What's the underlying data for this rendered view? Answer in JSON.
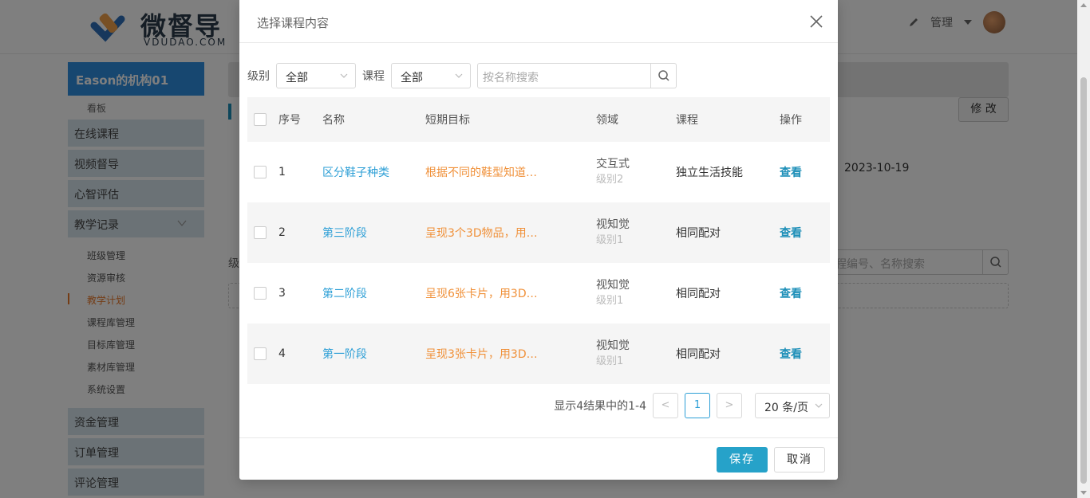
{
  "app": {
    "logo_cn": "微督导",
    "logo_en": "VDUDAO.COM",
    "user_menu_label": "管理"
  },
  "sidebar": {
    "org_name": "Eason的机构01",
    "dashboard_label": "看板",
    "items": [
      {
        "label": "在线课程"
      },
      {
        "label": "视频督导"
      },
      {
        "label": "心智评估"
      },
      {
        "label": "教学记录"
      }
    ],
    "teaching_children": [
      {
        "label": "班级管理"
      },
      {
        "label": "资源审核"
      },
      {
        "label": "教学计划"
      },
      {
        "label": "课程库管理"
      },
      {
        "label": "目标库管理"
      },
      {
        "label": "素材库管理"
      },
      {
        "label": "系统设置"
      }
    ],
    "bottom_items": [
      {
        "label": "资金管理"
      },
      {
        "label": "订单管理"
      },
      {
        "label": "评论管理"
      }
    ]
  },
  "background": {
    "edit_button": "修 改",
    "date": "2023-10-19",
    "search_placeholder": "程编号、名称搜索",
    "left_label": "级",
    "section_mark": "扌"
  },
  "modal": {
    "title": "选择课程内容",
    "filters": {
      "level_label": "级别",
      "level_value": "全部",
      "course_label": "课程",
      "course_value": "全部",
      "search_placeholder": "按名称搜索"
    },
    "columns": {
      "no": "序号",
      "name": "名称",
      "goal": "短期目标",
      "area": "领域",
      "course": "课程",
      "op": "操作"
    },
    "rows": [
      {
        "no": "1",
        "name": "区分鞋子种类",
        "goal": "根据不同的鞋型知道…",
        "area": "交互式",
        "level": "级别2",
        "course": "独立生活技能",
        "op": "查看"
      },
      {
        "no": "2",
        "name": "第三阶段",
        "goal": "呈现3个3D物品，用…",
        "area": "视知觉",
        "level": "级别1",
        "course": "相同配对",
        "op": "查看"
      },
      {
        "no": "3",
        "name": "第二阶段",
        "goal": "呈现6张卡片，用3D…",
        "area": "视知觉",
        "level": "级别1",
        "course": "相同配对",
        "op": "查看"
      },
      {
        "no": "4",
        "name": "第一阶段",
        "goal": "呈现3张卡片，用3D…",
        "area": "视知觉",
        "level": "级别1",
        "course": "相同配对",
        "op": "查看"
      }
    ],
    "pagination": {
      "info": "显示4结果中的1-4",
      "prev": "<",
      "current_page": "1",
      "next": ">",
      "page_size": "20 条/页"
    },
    "footer": {
      "save": "保存",
      "cancel": "取消"
    }
  },
  "colors": {
    "accent": "#26a2c9",
    "link": "#2d9fd6",
    "goal": "#f0913a",
    "org_bg": "#2f8fe0"
  }
}
